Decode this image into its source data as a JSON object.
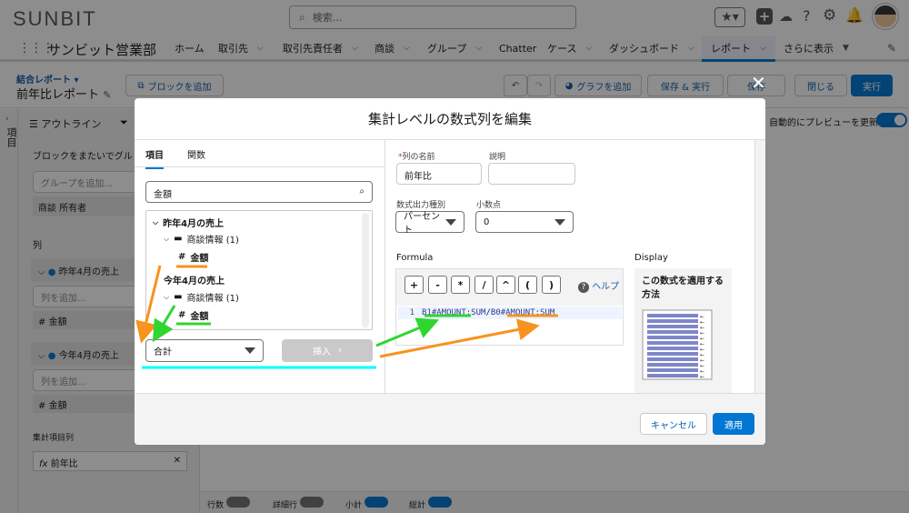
{
  "brand": {
    "logo": "SUNBIT",
    "app_name": "サンビット営業部"
  },
  "search": {
    "placeholder": "検索..."
  },
  "nav": {
    "items": [
      {
        "label": "ホーム"
      },
      {
        "label": "取引先"
      },
      {
        "label": "取引先責任者"
      },
      {
        "label": "商談"
      },
      {
        "label": "グループ"
      },
      {
        "label": "Chatter"
      },
      {
        "label": "ケース"
      },
      {
        "label": "ダッシュボード"
      },
      {
        "label": "レポート",
        "active": true
      },
      {
        "label": "さらに表示"
      }
    ]
  },
  "report": {
    "type_label": "結合レポート",
    "title": "前年比レポート",
    "add_block": "ブロックを追加",
    "add_chart": "グラフを追加",
    "save_run": "保存 & 実行",
    "save": "保存",
    "close": "閉じる",
    "run": "実行",
    "auto_preview": "自動的にプレビューを更新"
  },
  "sidebar": {
    "vertical_tab": "項目",
    "outline_tab": "アウトライン",
    "group_across": "ブロックをまたいでグル",
    "group_add_placeholder": "グループを追加...",
    "group_chip": "商談 所有者",
    "columns_heading": "列",
    "block1": {
      "name": "昨年4月の売上",
      "col_placeholder": "列を追加...",
      "col": "金額"
    },
    "block2": {
      "name": "今年4月の売上",
      "col_placeholder": "列を追加...",
      "col": "金額"
    },
    "summary_heading": "集計項目列",
    "summary_item": "前年比",
    "bottom_toggles": [
      "行数",
      "詳細行",
      "小計",
      "総計"
    ]
  },
  "modal": {
    "title": "集計レベルの数式列を編集",
    "tabs": [
      "項目",
      "関数"
    ],
    "field_search": "金額",
    "tree": {
      "block1": "昨年4月の売上",
      "block1_folder": "商談情報 (1)",
      "block1_field": "金額",
      "block2": "今年4月の売上",
      "block2_folder": "商談情報 (1)",
      "block2_field": "金額"
    },
    "summary_select": "合計",
    "insert_button": "挿入",
    "column_name_label": "列の名前",
    "column_name_value": "前年比",
    "description_label": "説明",
    "format_label": "数式出力種別",
    "format_value": "パーセント",
    "decimal_label": "小数点",
    "decimal_value": "0",
    "formula_label": "Formula",
    "operators": [
      "+",
      "-",
      "*",
      "/",
      "^",
      "(",
      ")"
    ],
    "help": "ヘルプ",
    "line_number": "1",
    "formula_part1": "B1#AMOUNT:SUM",
    "formula_op": " / ",
    "formula_part2": "B0#AMOUNT:SUM",
    "display_label": "Display",
    "display_heading": "この数式を適用する方法",
    "cancel": "キャンセル",
    "apply": "適用"
  },
  "colors": {
    "brand_blue": "#0176d3",
    "green_annotation": "#2fd62f",
    "orange_annotation": "#f7931e",
    "cyan_annotation": "#00ffff"
  }
}
